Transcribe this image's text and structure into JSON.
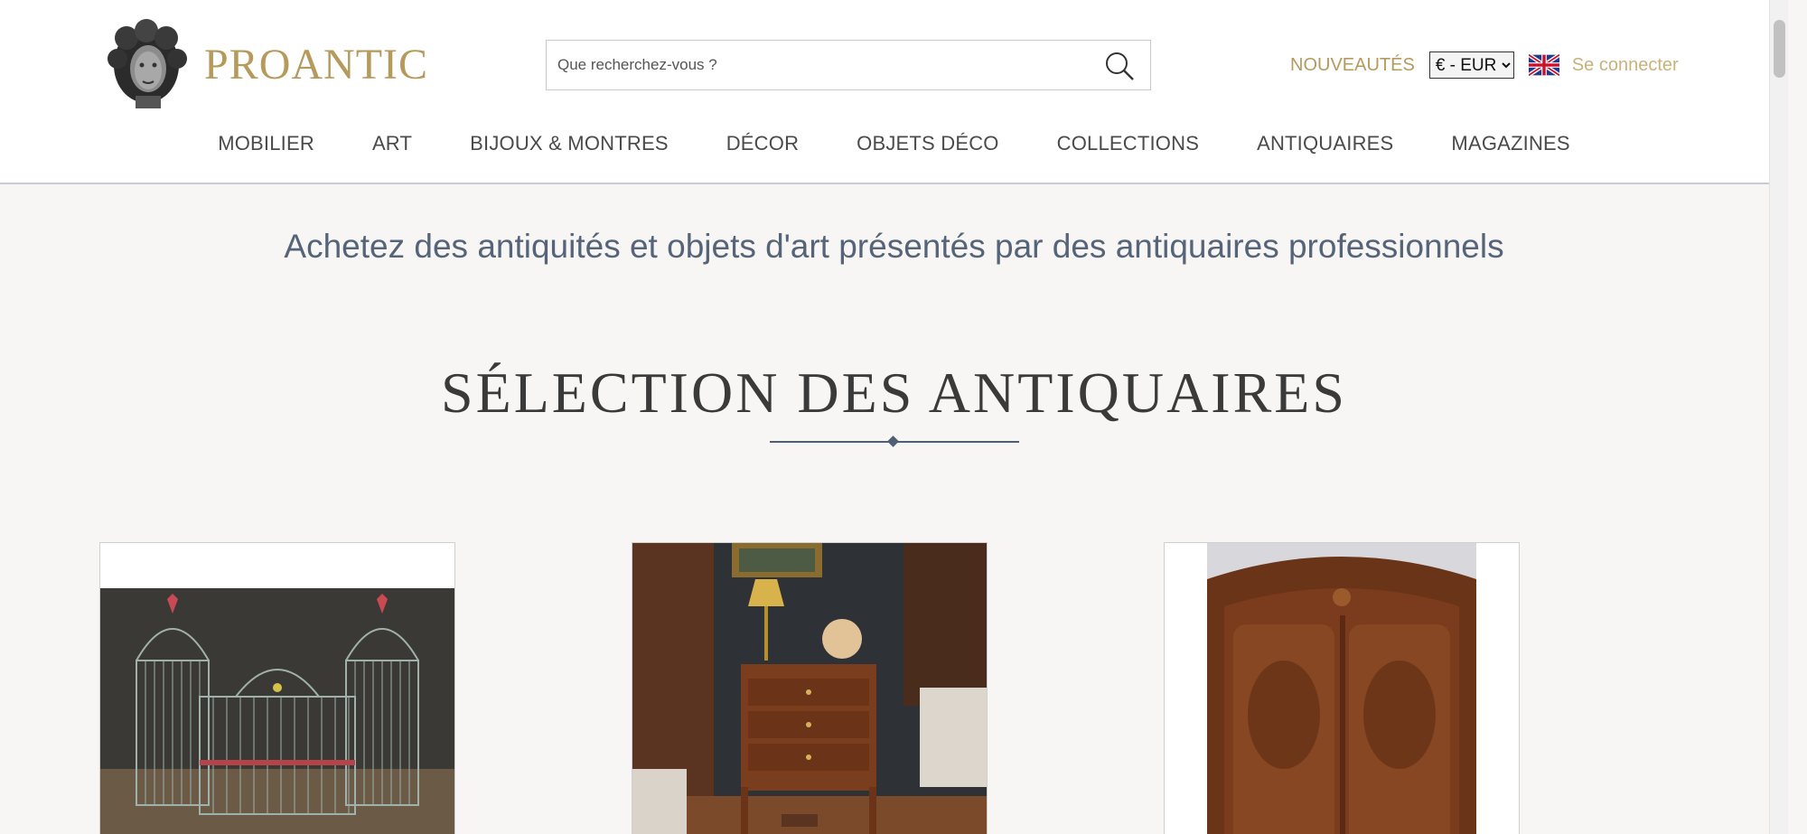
{
  "brand": {
    "name": "PROANTIC"
  },
  "search": {
    "placeholder": "Que recherchez-vous ?"
  },
  "header_links": {
    "nouveautes": "NOUVEAUTÉS",
    "login": "Se connecter"
  },
  "currency": {
    "selected": "€ - EUR"
  },
  "nav": [
    {
      "label": "MOBILIER"
    },
    {
      "label": "ART"
    },
    {
      "label": "BIJOUX & MONTRES"
    },
    {
      "label": "DÉCOR"
    },
    {
      "label": "OBJETS DÉCO"
    },
    {
      "label": "COLLECTIONS"
    },
    {
      "label": "ANTIQUAIRES"
    },
    {
      "label": "MAGAZINES"
    }
  ],
  "main": {
    "tagline": "Achetez des antiquités et objets d'art présentés par des antiquaires professionnels",
    "section_title": "SÉLECTION DES ANTIQUAIRES"
  },
  "icons": {
    "search": "search-icon",
    "flag": "uk-flag-icon",
    "logo": "bust-logo-icon"
  },
  "colors": {
    "gold": "#b59a5c",
    "navy": "#4e5e74",
    "bg": "#f7f6f4"
  }
}
